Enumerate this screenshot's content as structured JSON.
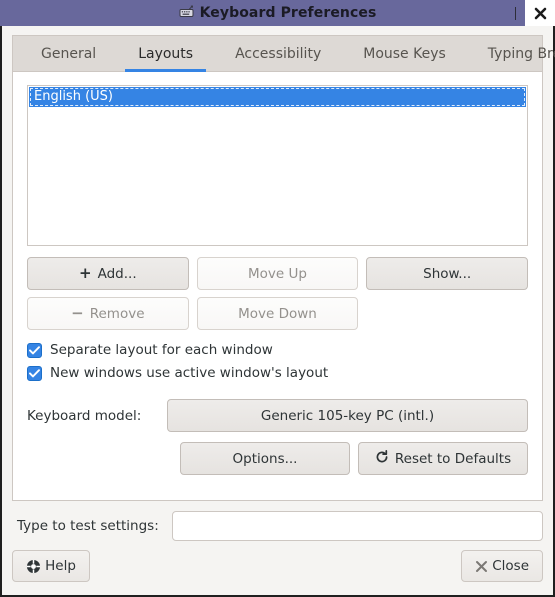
{
  "window": {
    "title": "Keyboard Preferences",
    "title_icon": "keyboard-icon",
    "close_icon": "close-icon"
  },
  "tabs": [
    {
      "label": "General",
      "active": false
    },
    {
      "label": "Layouts",
      "active": true
    },
    {
      "label": "Accessibility",
      "active": false
    },
    {
      "label": "Mouse Keys",
      "active": false
    },
    {
      "label": "Typing Break",
      "active": false
    }
  ],
  "layouts": {
    "items": [
      {
        "label": "English (US)",
        "selected": true
      }
    ]
  },
  "buttons": {
    "add": {
      "label": "Add...",
      "glyph": "+",
      "disabled": false
    },
    "move_up": {
      "label": "Move Up",
      "disabled": true
    },
    "show": {
      "label": "Show...",
      "disabled": false
    },
    "remove": {
      "label": "Remove",
      "glyph": "−",
      "disabled": true
    },
    "move_down": {
      "label": "Move Down",
      "disabled": true
    }
  },
  "checkboxes": [
    {
      "label": "Separate layout for each window",
      "checked": true
    },
    {
      "label": "New windows use active window's layout",
      "checked": true
    }
  ],
  "keyboard_model": {
    "label": "Keyboard model:",
    "value": "Generic 105-key PC (intl.)"
  },
  "options_row": {
    "options": {
      "label": "Options..."
    },
    "reset": {
      "label": "Reset to Defaults",
      "icon": "refresh-icon"
    }
  },
  "test": {
    "label": "Type to test settings:",
    "value": "",
    "placeholder": ""
  },
  "actions": {
    "help": {
      "label": "Help",
      "icon": "lifebuoy-icon"
    },
    "close": {
      "label": "Close",
      "icon": "close-x-icon"
    }
  },
  "colors": {
    "titlebar": "#68689c",
    "accent": "#3584e4",
    "selection": "#3584e4",
    "window_bg": "#f5f4f2",
    "tabstrip_bg": "#ddd9d5"
  }
}
